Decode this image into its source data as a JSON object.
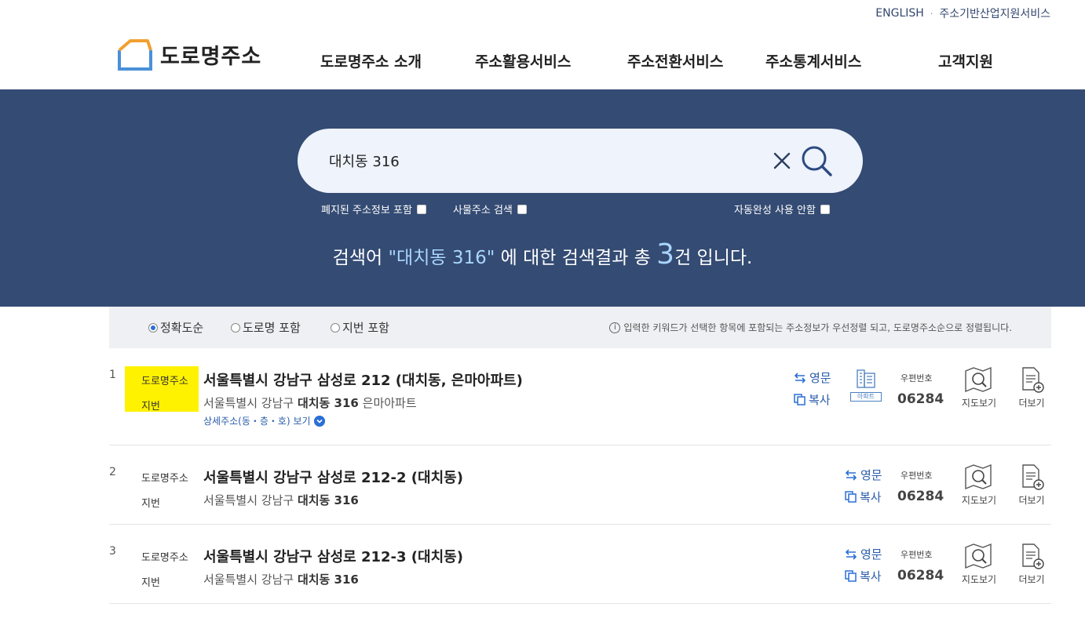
{
  "util": {
    "english": "ENGLISH",
    "separator": "·",
    "industry": "주소기반산업지원서비스"
  },
  "header": {
    "logo_text": "도로명주소",
    "nav": [
      "도로명주소 소개",
      "주소활용서비스",
      "주소전환서비스",
      "주소통계서비스",
      "고객지원"
    ]
  },
  "search": {
    "query": "대치동 316",
    "options": {
      "include_abolished": "폐지된 주소정보 포함",
      "thing_address": "사물주소 검색",
      "no_autocomplete": "자동완성 사용 안함"
    },
    "result_prefix": "검색어 ",
    "result_keyword": "\"대치동 316\"",
    "result_middle": " 에 대한 검색결과 총 ",
    "result_count": "3",
    "result_suffix": "건 입니다."
  },
  "sort": {
    "options": [
      "정확도순",
      "도로명 포함",
      "지번 포함"
    ],
    "selected": 0,
    "info": "입력한 키워드가 선택한 항목에 포함되는 주소정보가 우선정렬 되고, 도로명주소순으로 정렬됩니다."
  },
  "results": [
    {
      "num": "1",
      "road_label": "도로명주소",
      "jibun_label": "지번",
      "road": "서울특별시 강남구 삼성로 212 (대치동, 은마아파트)",
      "jibun_prefix": "서울특별시 강남구 ",
      "jibun_bold": "대치동 316",
      "jibun_suffix": " 은마아파트",
      "detail": "상세주소(동・층・호) 보기",
      "apt_label": "아파트",
      "english": "영문",
      "copy": "복사",
      "zip_label": "우편번호",
      "zip": "06284",
      "map": "지도보기",
      "more": "더보기"
    },
    {
      "num": "2",
      "road_label": "도로명주소",
      "jibun_label": "지번",
      "road": "서울특별시 강남구 삼성로 212-2 (대치동)",
      "jibun_prefix": "서울특별시 강남구 ",
      "jibun_bold": "대치동 316",
      "jibun_suffix": "",
      "english": "영문",
      "copy": "복사",
      "zip_label": "우편번호",
      "zip": "06284",
      "map": "지도보기",
      "more": "더보기"
    },
    {
      "num": "3",
      "road_label": "도로명주소",
      "jibun_label": "지번",
      "road": "서울특별시 강남구 삼성로 212-3 (대치동)",
      "jibun_prefix": "서울특별시 강남구 ",
      "jibun_bold": "대치동 316",
      "jibun_suffix": "",
      "english": "영문",
      "copy": "복사",
      "zip_label": "우편번호",
      "zip": "06284",
      "map": "지도보기",
      "more": "더보기"
    }
  ],
  "colors": {
    "band": "#344b73",
    "accent": "#2a5caa",
    "highlight": "#fff200",
    "keyword": "#a9d6ff"
  }
}
